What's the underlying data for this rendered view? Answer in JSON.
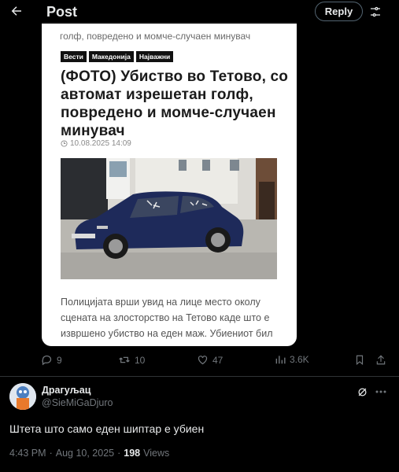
{
  "header": {
    "title": "Post",
    "reply_label": "Reply",
    "back_icon": "arrow-left-icon",
    "filter_icon": "sliders-icon"
  },
  "embed": {
    "previous_line": "голф, повредено и момче-случаен минувач",
    "tags": [
      "Вести",
      "Македонија",
      "Најважни"
    ],
    "headline": "(ФОТО) Убиство во Тетово, со автомат изрешетан голф, повредено и момче-случаен минувач",
    "date": "10.08.2025 14:09",
    "body": "Полицијата врши увид на лице место околу сцената на злосторство на Тетово каде што е извршено убиство на еден маж. Убиениот бил"
  },
  "actions": {
    "replies": "9",
    "reposts": "10",
    "likes": "47",
    "views": "3.6K"
  },
  "reply": {
    "display_name": "Драгуљац",
    "handle": "@SieMiGaDjuro",
    "text": "Штета што само еден шиптар е убиен",
    "time": "4:43 PM",
    "dot": "·",
    "date": "Aug 10, 2025",
    "views_count": "198",
    "views_label": "Views"
  },
  "colors": {
    "background": "#000000",
    "text_primary": "#e7e9ea",
    "text_secondary": "#71767b",
    "border": "#2f3336"
  }
}
